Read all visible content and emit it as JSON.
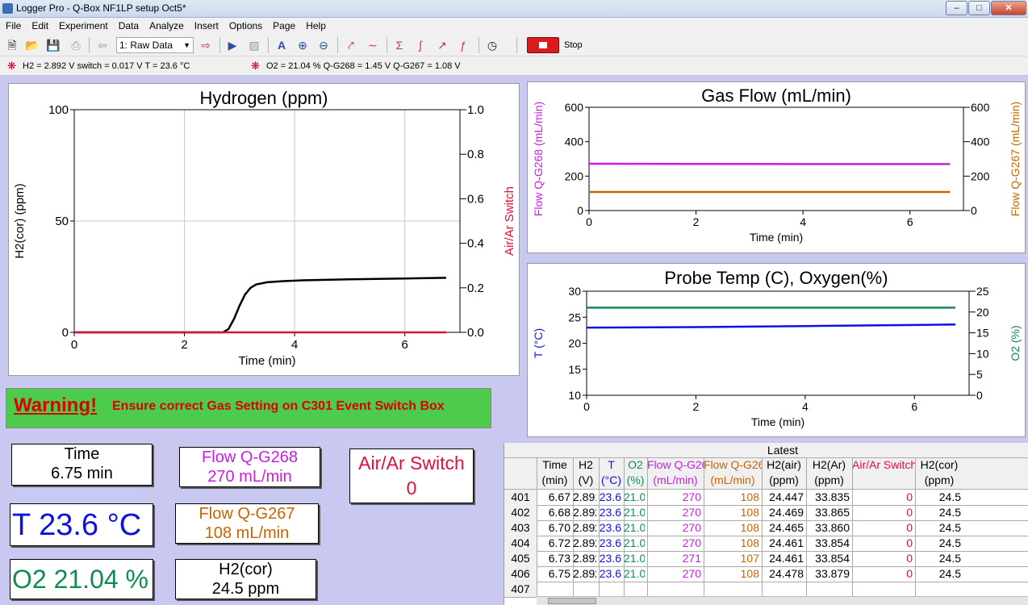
{
  "window": {
    "title": "Logger Pro - Q-Box NF1LP setup  Oct5*"
  },
  "menu": [
    "File",
    "Edit",
    "Experiment",
    "Data",
    "Analyze",
    "Insert",
    "Options",
    "Page",
    "Help"
  ],
  "toolbar": {
    "page_select": "1: Raw Data",
    "stop_label": "Stop"
  },
  "sensors": {
    "group1": "H2 = 2.892 V  switch = 0.017 V  T = 23.6 °C",
    "group2": "O2 = 21.04 %  Q-G268 = 1.45 V  Q-G267  = 1.08 V"
  },
  "colors": {
    "black": "#000000",
    "red": "#e0103c",
    "magenta": "#c81ee0",
    "orange": "#c86400",
    "blue": "#1010e0",
    "green": "#108c50"
  },
  "chart_data": [
    {
      "type": "line",
      "title": "Hydrogen (ppm)",
      "xlabel": "Time (min)",
      "ylabel": "H2(cor) (ppm)",
      "y2label": "Air/Ar Switch",
      "xlim": [
        0,
        7
      ],
      "ylim": [
        0,
        100
      ],
      "y2lim": [
        0,
        1
      ],
      "xticks": [
        "0",
        "2",
        "4",
        "6"
      ],
      "yticks": [
        "0",
        "50",
        "100"
      ],
      "y2ticks": [
        "0.0",
        "0.2",
        "0.4",
        "0.6",
        "0.8",
        "1.0"
      ],
      "grid": true,
      "series": [
        {
          "color": "#000000",
          "axis": "left",
          "x": [
            0,
            2.7,
            2.8,
            2.9,
            3.0,
            3.1,
            3.2,
            3.3,
            3.5,
            3.8,
            4.2,
            5.0,
            6.0,
            6.75
          ],
          "y": [
            0,
            0,
            1.5,
            6,
            12,
            17,
            20,
            21.5,
            22.5,
            23,
            23.4,
            23.8,
            24.2,
            24.5
          ]
        },
        {
          "color": "#e0103c",
          "axis": "right",
          "x": [
            0,
            6.75
          ],
          "y": [
            0,
            0
          ]
        }
      ]
    },
    {
      "type": "line",
      "title": "Gas Flow  (mL/min)",
      "xlabel": "Time (min)",
      "ylabel": "Flow Q-G268 (mL/min)",
      "y2label": "Flow Q-G267 (mL/min)",
      "xlim": [
        0,
        7
      ],
      "ylim": [
        0,
        600
      ],
      "y2lim": [
        0,
        600
      ],
      "xticks": [
        "0",
        "2",
        "4",
        "6"
      ],
      "yticks": [
        "0",
        "200",
        "400",
        "600"
      ],
      "y2ticks": [
        "0",
        "200",
        "400",
        "600"
      ],
      "grid": false,
      "series": [
        {
          "color": "#c81ee0",
          "axis": "left",
          "x": [
            0,
            2,
            4,
            6.75
          ],
          "y": [
            272,
            271,
            270,
            270
          ]
        },
        {
          "color": "#c86400",
          "axis": "right",
          "x": [
            0,
            6.75
          ],
          "y": [
            108,
            108
          ]
        }
      ]
    },
    {
      "type": "line",
      "title": "Probe Temp (C), Oxygen(%)",
      "xlabel": "Time (min)",
      "ylabel": "T (°C)",
      "y2label": "O2 (%)",
      "xlim": [
        0,
        7
      ],
      "ylim": [
        10,
        30
      ],
      "y2lim": [
        0,
        25
      ],
      "xticks": [
        "0",
        "2",
        "4",
        "6"
      ],
      "yticks": [
        "10",
        "15",
        "20",
        "25",
        "30"
      ],
      "y2ticks": [
        "0",
        "5",
        "10",
        "15",
        "20",
        "25"
      ],
      "grid": false,
      "series": [
        {
          "color": "#1010e0",
          "axis": "left",
          "x": [
            0,
            2,
            4,
            6.75
          ],
          "y": [
            23.0,
            23.1,
            23.3,
            23.6
          ]
        },
        {
          "color": "#108c50",
          "axis": "right",
          "x": [
            0,
            6.75
          ],
          "y": [
            21.04,
            21.04
          ]
        }
      ]
    }
  ],
  "warning": {
    "word": "Warning!",
    "message": "Ensure correct Gas Setting on C301 Event Switch Box"
  },
  "meters": {
    "time_label": "Time",
    "time_value": "6.75 min",
    "flow268_label": "Flow Q-G268",
    "flow268_value": "270 mL/min",
    "switch_label": "Air/Ar Switch",
    "switch_value": "0",
    "temp": "T 23.6 °C",
    "flow267_label": "Flow Q-G267",
    "flow267_value": "108 mL/min",
    "o2": "O2 21.04 %",
    "h2cor_label": "H2(cor)",
    "h2cor_value": "24.5 ppm"
  },
  "table": {
    "group": "Latest",
    "headers": [
      [
        "Time",
        "(min)"
      ],
      [
        "H2",
        "(V)"
      ],
      [
        "T",
        "(°C)"
      ],
      [
        "O2",
        "(%)"
      ],
      [
        "Flow Q-G268",
        "(mL/min)"
      ],
      [
        "Flow Q-G267",
        "(mL/min)"
      ],
      [
        "H2(air)",
        "(ppm)"
      ],
      [
        "H2(Ar)",
        "(ppm)"
      ],
      [
        "Air/Ar Switch",
        ""
      ],
      [
        "H2(cor)",
        "(ppm)"
      ]
    ],
    "rows": [
      {
        "n": "401",
        "cells": [
          "6.67",
          "2.891",
          "23.6",
          "21.03",
          "270",
          "108",
          "24.447",
          "33.835",
          "0",
          "24.5"
        ]
      },
      {
        "n": "402",
        "cells": [
          "6.68",
          "2.892",
          "23.6",
          "21.03",
          "270",
          "108",
          "24.469",
          "33.865",
          "0",
          "24.5"
        ]
      },
      {
        "n": "403",
        "cells": [
          "6.70",
          "2.892",
          "23.6",
          "21.04",
          "270",
          "108",
          "24.465",
          "33.860",
          "0",
          "24.5"
        ]
      },
      {
        "n": "404",
        "cells": [
          "6.72",
          "2.892",
          "23.6",
          "21.04",
          "270",
          "108",
          "24.461",
          "33.854",
          "0",
          "24.5"
        ]
      },
      {
        "n": "405",
        "cells": [
          "6.73",
          "2.892",
          "23.6",
          "21.04",
          "271",
          "107",
          "24.461",
          "33.854",
          "0",
          "24.5"
        ]
      },
      {
        "n": "406",
        "cells": [
          "6.75",
          "2.892",
          "23.6",
          "21.04",
          "270",
          "108",
          "24.478",
          "33.879",
          "0",
          "24.5"
        ]
      },
      {
        "n": "407",
        "cells": [
          "",
          "",
          "",
          "",
          "",
          "",
          "",
          "",
          "",
          ""
        ]
      }
    ]
  }
}
